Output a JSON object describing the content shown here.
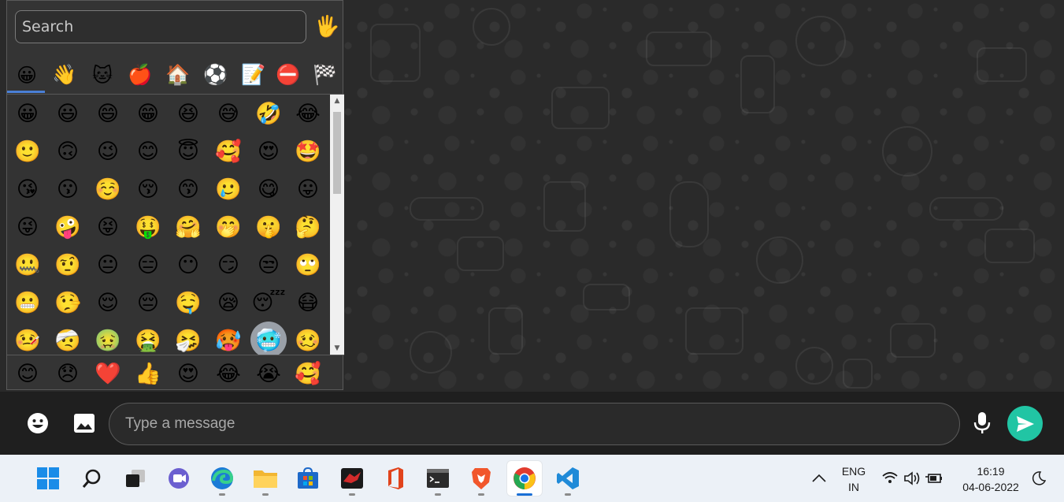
{
  "emoji_picker": {
    "search_placeholder": "Search",
    "skin_tone_emoji": "🖐️",
    "categories": [
      {
        "name": "smileys",
        "glyph": "😀"
      },
      {
        "name": "people",
        "glyph": "👋"
      },
      {
        "name": "animals",
        "glyph": "🐱"
      },
      {
        "name": "food",
        "glyph": "🍎"
      },
      {
        "name": "travel",
        "glyph": "🏠"
      },
      {
        "name": "activities",
        "glyph": "⚽"
      },
      {
        "name": "objects",
        "glyph": "📝"
      },
      {
        "name": "symbols",
        "glyph": "⛔"
      },
      {
        "name": "flags",
        "glyph": "🏁"
      }
    ],
    "grid": [
      [
        "😀",
        "😃",
        "😄",
        "😁",
        "😆",
        "😅",
        "🤣",
        "😂"
      ],
      [
        "🙂",
        "🙃",
        "😉",
        "😊",
        "😇",
        "🥰",
        "😍",
        "🤩"
      ],
      [
        "😘",
        "😗",
        "☺️",
        "😚",
        "😙",
        "🥲",
        "😋",
        "😛"
      ],
      [
        "😜",
        "🤪",
        "😝",
        "🤑",
        "🤗",
        "🤭",
        "🤫",
        "🤔"
      ],
      [
        "🤐",
        "🤨",
        "😐",
        "😑",
        "😶",
        "😏",
        "😒",
        "🙄"
      ],
      [
        "😬",
        "🤥",
        "😌",
        "😔",
        "🤤",
        "😪",
        "😴",
        "😷"
      ],
      [
        "🤒",
        "🤕",
        "🤢",
        "🤮",
        "🤧",
        "🥵",
        "🥶",
        "🥴"
      ]
    ],
    "selected_emoji": "🥶",
    "recents": [
      "😊",
      "😞",
      "❤️",
      "👍",
      "😍",
      "😂",
      "😭",
      "🥰"
    ]
  },
  "composer": {
    "emoji_icon": "emoji-icon",
    "attach_icon": "image-icon",
    "placeholder": "Type a message",
    "mic_icon": "microphone-icon",
    "send_icon": "send-icon",
    "send_color": "#21c5a4"
  },
  "taskbar": {
    "apps": [
      "start",
      "search",
      "task-view",
      "teams-chat",
      "edge",
      "file-explorer",
      "microsoft-store",
      "game-app",
      "office",
      "terminal",
      "brave",
      "chrome",
      "vscode"
    ],
    "active_app": "chrome",
    "language_line1": "ENG",
    "language_line2": "IN",
    "time": "16:19",
    "date": "04-06-2022"
  }
}
